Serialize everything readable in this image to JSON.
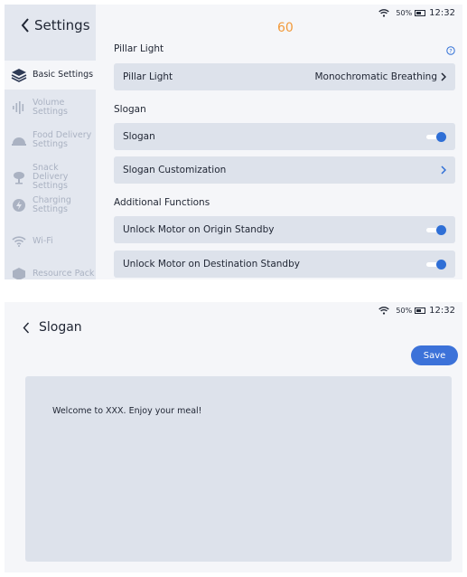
{
  "screen1": {
    "back_label": "Settings",
    "counter": "60",
    "status": {
      "battery": "50%",
      "time": "12:32"
    },
    "sidebar": {
      "items": [
        {
          "label": "Basic Settings",
          "icon": "layers-icon",
          "active": true
        },
        {
          "label": "Volume Settings",
          "icon": "volume-bars-icon",
          "active": false
        },
        {
          "label": "Food Delivery Settings",
          "icon": "cloche-icon",
          "active": false
        },
        {
          "label": "Snack Delivery Settings",
          "icon": "snack-icon",
          "active": false
        },
        {
          "label": "Charging Settings",
          "icon": "charging-icon",
          "active": false
        },
        {
          "label": "Wi-Fi",
          "icon": "wifi-icon",
          "active": false
        },
        {
          "label": "Resource Pack",
          "icon": "package-icon",
          "active": false
        }
      ]
    },
    "sections": {
      "pillar_light": {
        "title": "Pillar Light",
        "row_label": "Pillar Light",
        "row_value": "Monochromatic Breathing"
      },
      "slogan": {
        "title": "Slogan",
        "toggle_label": "Slogan",
        "toggle_on": true,
        "customize_label": "Slogan Customization"
      },
      "additional": {
        "title": "Additional Functions",
        "origin_label": "Unlock Motor on Origin Standby",
        "origin_on": true,
        "destination_label": "Unlock Motor on Destination Standby",
        "destination_on": true
      }
    }
  },
  "screen2": {
    "back_label": "Slogan",
    "status": {
      "battery": "50%",
      "time": "12:32"
    },
    "save_label": "Save",
    "slogan_text": "Welcome to XXX. Enjoy your meal!"
  },
  "colors": {
    "accent": "#3c72d9",
    "toggle_on": "#2f6fd6",
    "counter": "#f29a3b",
    "sidebar_bg": "#e3e7ef",
    "row_bg": "#dde2eb"
  }
}
